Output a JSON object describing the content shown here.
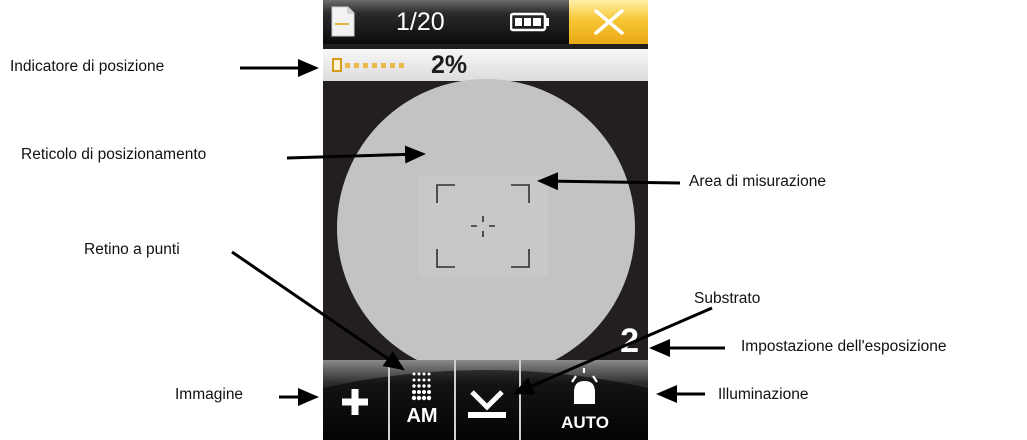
{
  "screen": {
    "counter": "1/20",
    "position_percent": "2%",
    "position_fill_fraction": 0.02,
    "exposure_setting": "2",
    "toolbar": {
      "screen_label": "AM",
      "illumination_label": "AUTO"
    },
    "icons": {
      "file": "document-icon",
      "battery": "battery-icon",
      "close": "close-icon",
      "image": "plus-icon",
      "dot_screen": "dot-grid-icon",
      "substrate": "substrate-icon",
      "illumination": "lamp-icon"
    },
    "colors": {
      "close_button": "#f7c634",
      "indicator_accent": "#e9b84a",
      "reticle_circle": "#c3c3c3",
      "screen_background": "#231f20"
    }
  },
  "callouts": {
    "indicatore_posizione": "Indicatore di posizione",
    "reticolo_posizionamento": "Reticolo di posizionamento",
    "area_misurazione": "Area di misurazione",
    "retino_punti": "Retino a punti",
    "substrato": "Substrato",
    "impostazione_esposizione": "Impostazione dell'esposizione",
    "immagine": "Immagine",
    "illuminazione": "Illuminazione"
  }
}
